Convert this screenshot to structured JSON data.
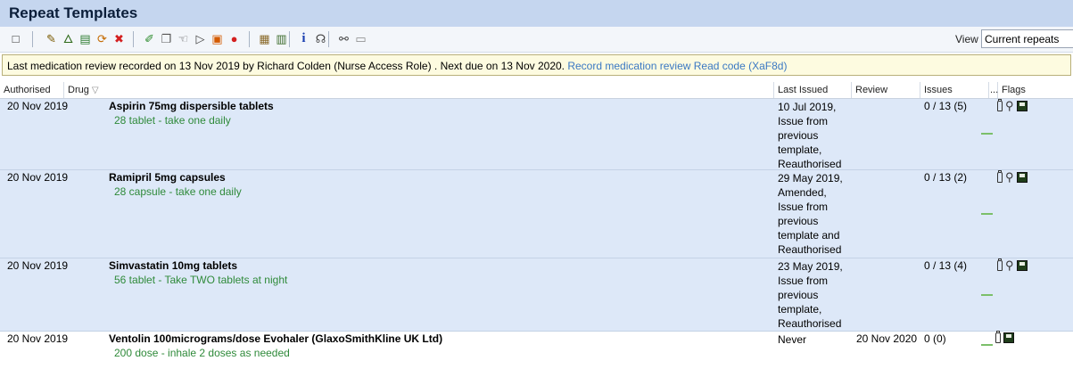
{
  "window": {
    "title": "Repeat Templates"
  },
  "toolbar": {
    "view_label": "View",
    "view_value": "Current repeats",
    "buttons": [
      {
        "name": "select-all-icon",
        "glyph": "□",
        "color": "#333333"
      },
      {
        "name": "authorise-icon",
        "glyph": "✎",
        "color": "#7a5a00"
      },
      {
        "name": "issue-icon",
        "glyph": "🜂",
        "color": "#2e6a1a"
      },
      {
        "name": "print-script-icon",
        "glyph": "▤",
        "color": "#2e7d32"
      },
      {
        "name": "review-icon",
        "glyph": "⟳",
        "color": "#c46a00"
      },
      {
        "name": "delete-icon",
        "glyph": "✖",
        "color": "#d42020"
      },
      {
        "name": "edit-icon",
        "glyph": "✐",
        "color": "#2a8a2a"
      },
      {
        "name": "copy-icon",
        "glyph": "❐",
        "color": "#555555"
      },
      {
        "name": "hand-icon",
        "glyph": "☜",
        "color": "#555555"
      },
      {
        "name": "play-icon",
        "glyph": "▷",
        "color": "#444444"
      },
      {
        "name": "form-icon",
        "glyph": "▣",
        "color": "#d45a00"
      },
      {
        "name": "record-icon",
        "glyph": "●",
        "color": "#d42020"
      },
      {
        "name": "grid-icon",
        "glyph": "▦",
        "color": "#8a6a2a"
      },
      {
        "name": "chart-icon",
        "glyph": "▥",
        "color": "#3a6a2a"
      },
      {
        "name": "info-icon",
        "glyph": "i",
        "color": "#1a3fb0"
      },
      {
        "name": "pharmacy-icon",
        "glyph": "☊",
        "color": "#444444"
      },
      {
        "name": "link-icon",
        "glyph": "⚯",
        "color": "#444444"
      },
      {
        "name": "notes-icon",
        "glyph": "▭",
        "color": "#888888"
      }
    ]
  },
  "review_banner": {
    "text": "Last medication review recorded on 13 Nov 2019 by Richard Colden (Nurse Access Role) . Next due on 13 Nov 2020. ",
    "link": "Record medication review Read code (XaF8d)"
  },
  "columns": {
    "authorised": "Authorised",
    "drug": "Drug",
    "sort_icon": "▽",
    "last_issued": "Last Issued",
    "review": "Review",
    "issues": "Issues",
    "extra": "...",
    "flags": "Flags"
  },
  "rows": [
    {
      "authorised": "20 Nov 2019",
      "drug": "Aspirin 75mg dispersible tablets",
      "dosage": "28 tablet - take one daily",
      "last_issued": "10 Jul 2019, Issue from previous template, Reauthorised",
      "review": "",
      "issues": "0 / 13 (5)",
      "flags": [
        "pill-icon",
        "person-icon",
        "save-icon"
      ]
    },
    {
      "authorised": "20 Nov 2019",
      "drug": "Ramipril 5mg capsules",
      "dosage": "28 capsule - take one daily",
      "last_issued": "29 May 2019, Amended, Issue from previous template and Reauthorised",
      "review": "",
      "issues": "0 / 13 (2)",
      "flags": [
        "pill-icon",
        "person-icon",
        "save-icon"
      ]
    },
    {
      "authorised": "20 Nov 2019",
      "drug": "Simvastatin 10mg tablets",
      "dosage": "56 tablet - Take TWO tablets at night",
      "last_issued": "23 May 2019, Issue from previous template, Reauthorised",
      "review": "",
      "issues": "0 / 13 (4)",
      "flags": [
        "pill-icon",
        "person-icon",
        "save-icon"
      ]
    },
    {
      "authorised": "20 Nov 2019",
      "drug": "Ventolin 100micrograms/dose Evohaler (GlaxoSmithKline UK Ltd)",
      "dosage": "200 dose - inhale 2 doses as needed",
      "last_issued": "Never",
      "review": "20 Nov 2020",
      "issues": "0 (0)",
      "flags": [
        "pill-icon",
        "save-icon"
      ]
    }
  ]
}
